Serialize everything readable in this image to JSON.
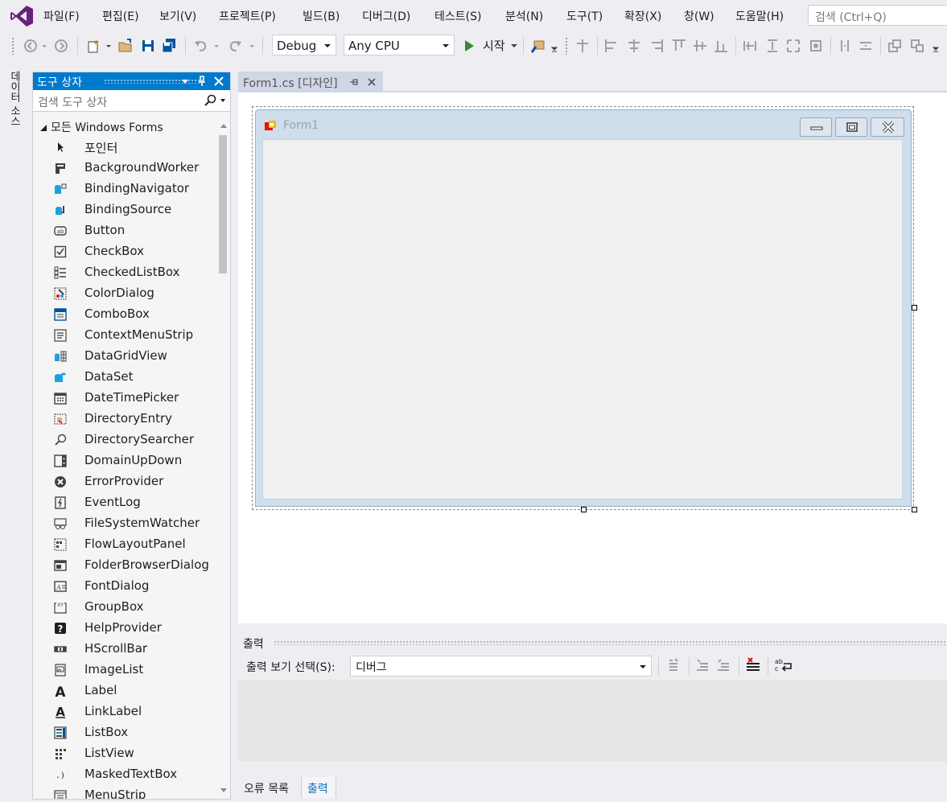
{
  "menu": {
    "items": [
      "파일(F)",
      "편집(E)",
      "보기(V)",
      "프로젝트(P)",
      "빌드(B)",
      "디버그(D)",
      "테스트(S)",
      "분석(N)",
      "도구(T)",
      "확장(X)",
      "창(W)",
      "도움말(H)"
    ],
    "search_placeholder": "검색 (Ctrl+Q)"
  },
  "toolbar": {
    "config": "Debug",
    "platform": "Any CPU",
    "start_label": "시작"
  },
  "side": {
    "data_sources_tab": "데이터 소스"
  },
  "toolbox": {
    "title": "도구 상자",
    "search_placeholder": "검색 도구 상자",
    "group": "모든 Windows Forms",
    "items": [
      "포인터",
      "BackgroundWorker",
      "BindingNavigator",
      "BindingSource",
      "Button",
      "CheckBox",
      "CheckedListBox",
      "ColorDialog",
      "ComboBox",
      "ContextMenuStrip",
      "DataGridView",
      "DataSet",
      "DateTimePicker",
      "DirectoryEntry",
      "DirectorySearcher",
      "DomainUpDown",
      "ErrorProvider",
      "EventLog",
      "FileSystemWatcher",
      "FlowLayoutPanel",
      "FolderBrowserDialog",
      "FontDialog",
      "GroupBox",
      "HelpProvider",
      "HScrollBar",
      "ImageList",
      "Label",
      "LinkLabel",
      "ListBox",
      "ListView",
      "MaskedTextBox",
      "MenuStrip"
    ]
  },
  "document": {
    "tab_label": "Form1.cs [디자인]",
    "form_title": "Form1"
  },
  "output": {
    "title": "출력",
    "select_label": "출력 보기 선택(S):",
    "select_value": "디버그"
  },
  "bottom_tabs": [
    "오류 목록",
    "출력"
  ],
  "colors": {
    "accent": "#007acc",
    "vs_purple": "#68217a"
  }
}
